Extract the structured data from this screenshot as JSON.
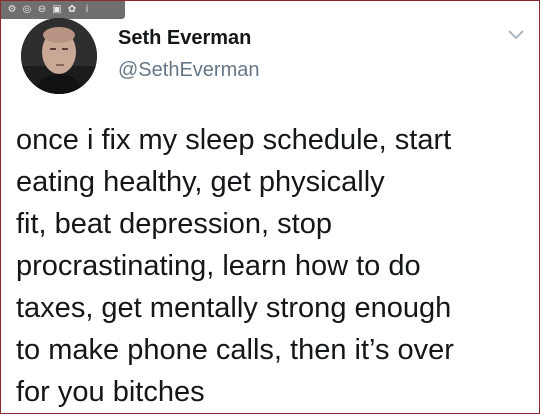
{
  "tweet": {
    "display_name": "Seth Everman",
    "handle": "@SethEverman",
    "text": "once i fix my sleep schedule, start\neating healthy, get physically\nfit, beat depression, stop\nprocrastinating, learn how to do\ntaxes, get mentally strong enough\nto make phone calls, then it’s over\nfor you bitches"
  },
  "icons": {
    "menu": "chevron-down-icon",
    "avatar": "profile-photo"
  },
  "colors": {
    "name": "#14171a",
    "handle": "#657786",
    "text": "#14171a",
    "border": "#8a2a2a"
  }
}
